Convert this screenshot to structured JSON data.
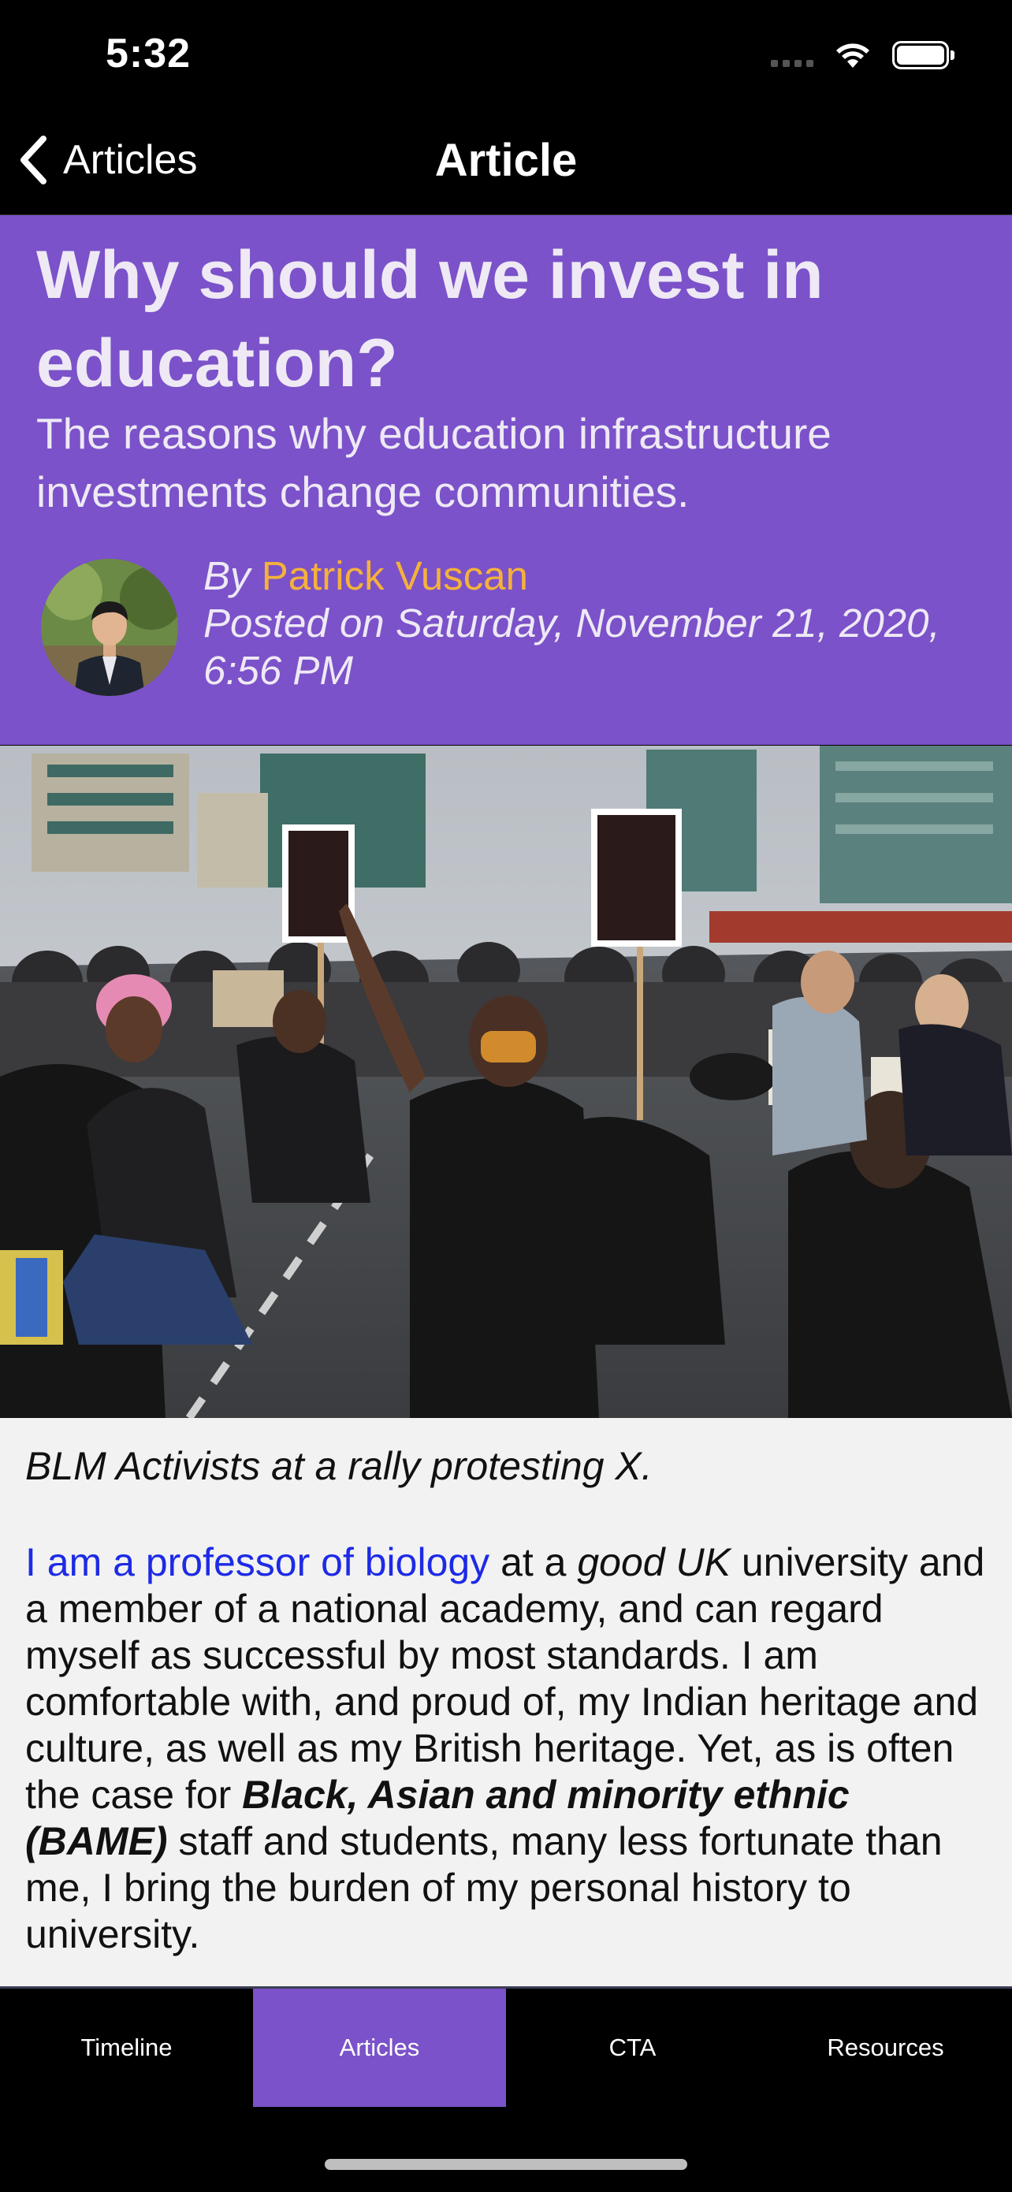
{
  "status_bar": {
    "time": "5:32"
  },
  "nav": {
    "back_label": "Articles",
    "title": "Article"
  },
  "article": {
    "title": "Why should we invest in education?",
    "subtitle": "The reasons why education infrastructure investments change communities.",
    "by_prefix": "By",
    "author": "Patrick Vuscan",
    "posted": "Posted on Saturday, November 21, 2020, 6:56 PM",
    "image_caption": "BLM Activists at a rally protesting X.",
    "body": {
      "link_text": "I am a professor of biology",
      "t1": " at a ",
      "em1": "good UK",
      "t2": " university and a member of a national academy, and can regard myself as successful by most standards. I am comfortable with, and proud of, my Indian heritage and culture, as well as my British heritage. Yet, as is often the case for ",
      "strong_em": "Black, Asian and minority ethnic (BAME)",
      "t3": " staff and students, many less fortunate than me, I bring the burden of my personal history to university."
    }
  },
  "tabs": [
    {
      "label": "Timeline",
      "active": false
    },
    {
      "label": "Articles",
      "active": true
    },
    {
      "label": "CTA",
      "active": false
    },
    {
      "label": "Resources",
      "active": false
    }
  ],
  "colors": {
    "header_bg": "#7b52c9",
    "author": "#f4b13b",
    "link": "#1d2ae6",
    "active_tab": "#7b52c9"
  },
  "icons": [
    "back-chevron-icon",
    "signal-icon",
    "wifi-icon",
    "battery-icon"
  ]
}
